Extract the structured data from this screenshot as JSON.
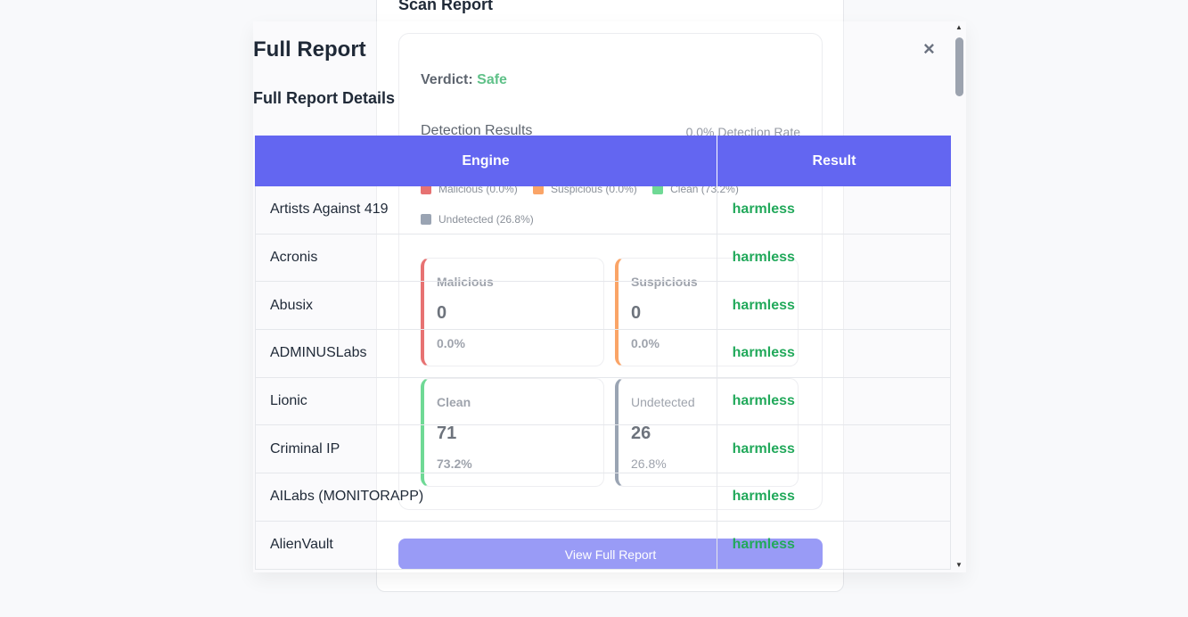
{
  "scan": {
    "title": "Scan Report",
    "verdict_label": "Verdict:",
    "verdict_value": "Safe",
    "detection_title": "Detection Results",
    "detection_rate": "0.0% Detection Rate",
    "legend": [
      {
        "label": "Malicious (0.0%)",
        "color": "#dc2626"
      },
      {
        "label": "Suspicious (0.0%)",
        "color": "#f97316"
      },
      {
        "label": "Clean (73.2%)",
        "color": "#22c55e"
      },
      {
        "label": "Undetected (26.8%)",
        "color": "#64748b"
      }
    ],
    "stats": [
      {
        "label": "Malicious",
        "value": "0",
        "percent": "0.0%",
        "color": "#dc2626"
      },
      {
        "label": "Suspicious",
        "value": "0",
        "percent": "0.0%",
        "color": "#f97316"
      },
      {
        "label": "Clean",
        "value": "71",
        "percent": "73.2%",
        "color": "#22c55e"
      },
      {
        "label": "Undetected",
        "value": "26",
        "percent": "26.8%",
        "color": "#64748b"
      }
    ],
    "view_button": "View Full Report"
  },
  "modal": {
    "title": "Full Report",
    "subtitle": "Full Report Details",
    "close": "×",
    "table": {
      "headers": [
        "Engine",
        "Result"
      ],
      "rows": [
        {
          "engine": "Artists Against 419",
          "result": "harmless"
        },
        {
          "engine": "Acronis",
          "result": "harmless"
        },
        {
          "engine": "Abusix",
          "result": "harmless"
        },
        {
          "engine": "ADMINUSLabs",
          "result": "harmless"
        },
        {
          "engine": "Lionic",
          "result": "harmless"
        },
        {
          "engine": "Criminal IP",
          "result": "harmless"
        },
        {
          "engine": "AILabs (MONITORAPP)",
          "result": "harmless"
        },
        {
          "engine": "AlienVault",
          "result": "harmless"
        }
      ]
    }
  },
  "scrollbar": {
    "up": "▲",
    "down": "▼"
  }
}
